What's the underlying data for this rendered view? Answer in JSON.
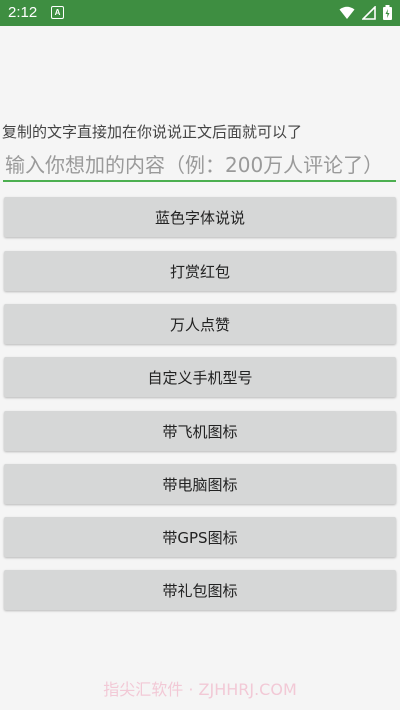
{
  "status_bar": {
    "time": "2:12",
    "notification_glyph": "A",
    "icons": [
      "wifi-icon",
      "signal-icon",
      "battery-charging-icon"
    ],
    "color": "#3e8e41"
  },
  "hint_text": "复制的文字直接加在你说说正文后面就可以了",
  "input": {
    "value": "",
    "placeholder": "输入你想加的内容（例：200万人评论了）",
    "underline_color": "#4caf50"
  },
  "buttons": [
    {
      "label": "蓝色字体说说"
    },
    {
      "label": "打赏红包"
    },
    {
      "label": "万人点赞"
    },
    {
      "label": "自定义手机型号"
    },
    {
      "label": "带飞机图标"
    },
    {
      "label": "带电脑图标"
    },
    {
      "label": "带GPS图标"
    },
    {
      "label": "带礼包图标"
    }
  ],
  "watermark": "指尖汇软件 · ZJHHRJ.COM"
}
